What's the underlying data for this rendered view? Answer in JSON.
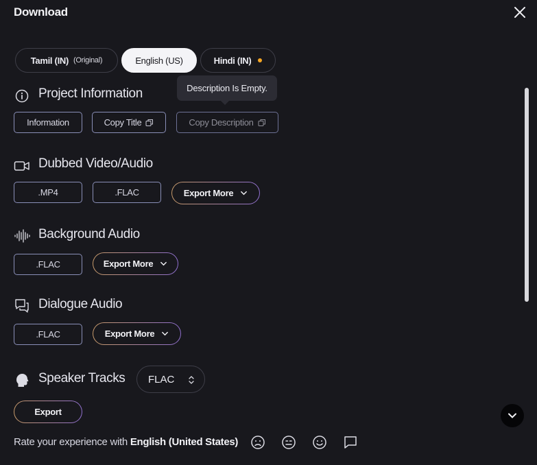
{
  "dialog": {
    "title": "Download"
  },
  "tabs": [
    {
      "label": "Tamil (IN)",
      "note": "(Original)"
    },
    {
      "label": "English (US)"
    },
    {
      "label": "Hindi (IN)",
      "dot_color": "#f5a623"
    }
  ],
  "tooltip": "Description Is Empty.",
  "sections": {
    "project_info": {
      "title": "Project Information",
      "buttons": {
        "information": "Information",
        "copy_title": "Copy Title",
        "copy_description": "Copy Description"
      }
    },
    "dubbed": {
      "title": "Dubbed Video/Audio",
      "buttons": {
        "mp4": ".MP4",
        "flac": ".FLAC",
        "export_more": "Export More"
      }
    },
    "background": {
      "title": "Background Audio",
      "buttons": {
        "flac": ".FLAC",
        "export_more": "Export More"
      }
    },
    "dialogue": {
      "title": "Dialogue Audio",
      "buttons": {
        "flac": ".FLAC",
        "export_more": "Export More"
      }
    },
    "speaker": {
      "title": "Speaker Tracks",
      "format": "FLAC",
      "export": "Export"
    }
  },
  "rating": {
    "prefix": "Rate your experience with",
    "language": "English (United States)"
  },
  "icons": [
    "close-icon",
    "info-icon",
    "video-camera-icon",
    "waveform-icon",
    "chat-bubbles-icon",
    "speaker-head-icon",
    "copy-icon",
    "chevron-down-icon",
    "sad-face-icon",
    "neutral-face-icon",
    "happy-face-icon",
    "feedback-icon"
  ]
}
